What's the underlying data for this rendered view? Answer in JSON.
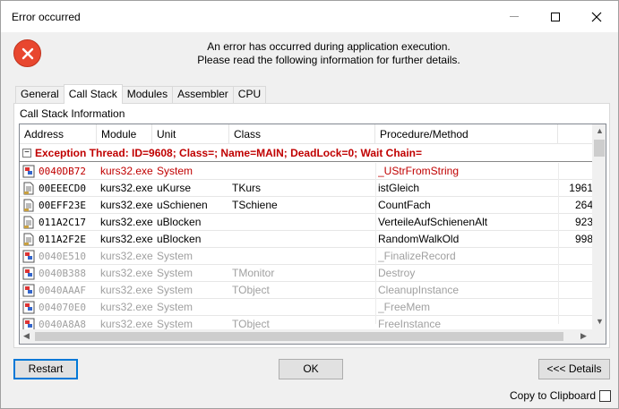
{
  "window": {
    "title": "Error occurred"
  },
  "titlebar_icons": [
    "minimize-icon",
    "maximize-icon",
    "close-icon"
  ],
  "message": {
    "line1": "An error has occurred during application execution.",
    "line2": "Please read the following information for further details."
  },
  "tabs": [
    {
      "label": "General",
      "active": false
    },
    {
      "label": "Call Stack",
      "active": true
    },
    {
      "label": "Modules",
      "active": false
    },
    {
      "label": "Assembler",
      "active": false
    },
    {
      "label": "CPU",
      "active": false
    }
  ],
  "panel": {
    "label": "Call Stack Information"
  },
  "columns": [
    "Address",
    "Module",
    "Unit",
    "Class",
    "Procedure/Method",
    ""
  ],
  "group": {
    "toggle": "−",
    "text": "Exception Thread: ID=9608; Class=; Name=MAIN; DeadLock=0; Wait Chain="
  },
  "rows": [
    {
      "icon": "unit-icon",
      "style": "red",
      "address": "0040DB72",
      "module": "kurs32.exe",
      "unit": "System",
      "class": "",
      "procedure": "_UStrFromString",
      "line": ""
    },
    {
      "icon": "source-icon",
      "style": "black",
      "address": "00EEECD0",
      "module": "kurs32.exe",
      "unit": "uKurse",
      "class": "TKurs",
      "procedure": "istGleich",
      "line": "1961"
    },
    {
      "icon": "source-icon",
      "style": "black",
      "address": "00EFF23E",
      "module": "kurs32.exe",
      "unit": "uSchienen",
      "class": "TSchiene",
      "procedure": "CountFach",
      "line": "264"
    },
    {
      "icon": "source-icon",
      "style": "black",
      "address": "011A2C17",
      "module": "kurs32.exe",
      "unit": "uBlocken",
      "class": "",
      "procedure": "VerteileAufSchienenAlt",
      "line": "923"
    },
    {
      "icon": "source-icon",
      "style": "black",
      "address": "011A2F2E",
      "module": "kurs32.exe",
      "unit": "uBlocken",
      "class": "",
      "procedure": "RandomWalkOld",
      "line": "998"
    },
    {
      "icon": "unit-icon",
      "style": "grey",
      "address": "0040E510",
      "module": "kurs32.exe",
      "unit": "System",
      "class": "",
      "procedure": "_FinalizeRecord",
      "line": ""
    },
    {
      "icon": "unit-icon",
      "style": "grey",
      "address": "0040B388",
      "module": "kurs32.exe",
      "unit": "System",
      "class": "TMonitor",
      "procedure": "Destroy",
      "line": ""
    },
    {
      "icon": "unit-icon",
      "style": "grey",
      "address": "0040AAAF",
      "module": "kurs32.exe",
      "unit": "System",
      "class": "TObject",
      "procedure": "CleanupInstance",
      "line": ""
    },
    {
      "icon": "unit-icon",
      "style": "grey",
      "address": "004070E0",
      "module": "kurs32.exe",
      "unit": "System",
      "class": "",
      "procedure": "_FreeMem",
      "line": ""
    },
    {
      "icon": "unit-icon",
      "style": "grey",
      "address": "0040A8A8",
      "module": "kurs32.exe",
      "unit": "System",
      "class": "TObject",
      "procedure": "FreeInstance",
      "line": ""
    }
  ],
  "buttons": {
    "restart": "Restart",
    "ok": "OK",
    "details": "<<< Details"
  },
  "clipboard": {
    "label": "Copy to Clipboard",
    "checked": false
  },
  "colors": {
    "error_red": "#e8472f",
    "text_red": "#c00000",
    "text_grey": "#a0a0a0",
    "focus_blue": "#0078d7"
  }
}
